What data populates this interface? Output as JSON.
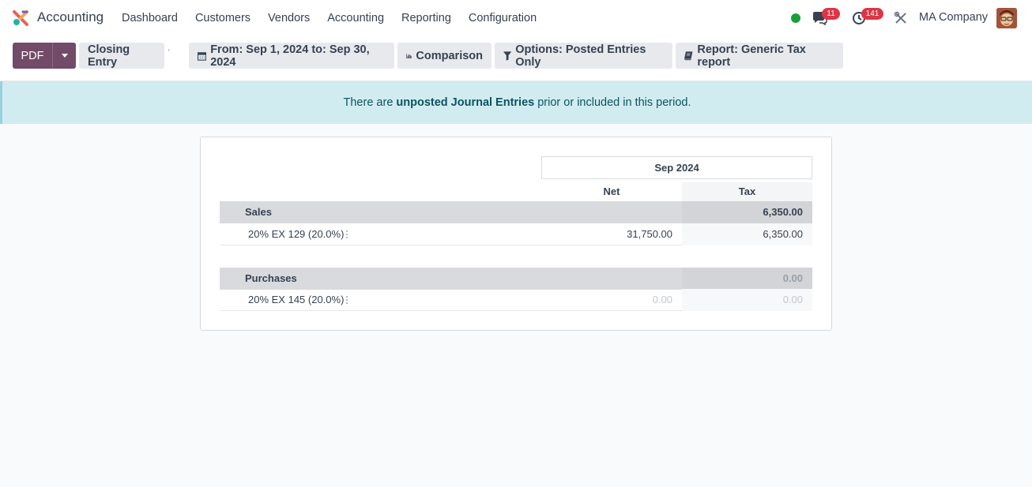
{
  "navbar": {
    "app_name": "Accounting",
    "menu": [
      "Dashboard",
      "Customers",
      "Vendors",
      "Accounting",
      "Reporting",
      "Configuration"
    ],
    "chat_count": "11",
    "activity_count": "141",
    "company": "MA Company",
    "status_color": "#1a9f3a"
  },
  "controls": {
    "pdf_label": "PDF",
    "closing_entry_label": "Closing Entry",
    "dot_mark": "·",
    "date_filter_label": "From: Sep 1, 2024 to: Sep 30, 2024",
    "comparison_label": "Comparison",
    "options_label": "Options: Posted Entries Only",
    "report_label": "Report: Generic Tax report",
    "icons": {
      "date": "calendar-icon",
      "comparison": "bar-chart-icon",
      "options": "filter-icon",
      "report": "book-icon"
    },
    "accent_color": "#714b67"
  },
  "alert": {
    "prefix": "There are",
    "link": "unposted Journal Entries",
    "suffix": "prior or included in this period."
  },
  "report": {
    "period_header": "Sep 2024",
    "columns": [
      "Net",
      "Tax"
    ],
    "sections": [
      {
        "name": "Sales",
        "tax": "6,350.00",
        "lines": [
          {
            "label": "20% EX 129 (20.0%)",
            "net": "31,750.00",
            "tax": "6,350.00"
          }
        ]
      },
      {
        "name": "Purchases",
        "tax": "0.00",
        "lines": [
          {
            "label": "20% EX 145 (20.0%)",
            "net": "0.00",
            "tax": "0.00"
          }
        ]
      }
    ]
  }
}
